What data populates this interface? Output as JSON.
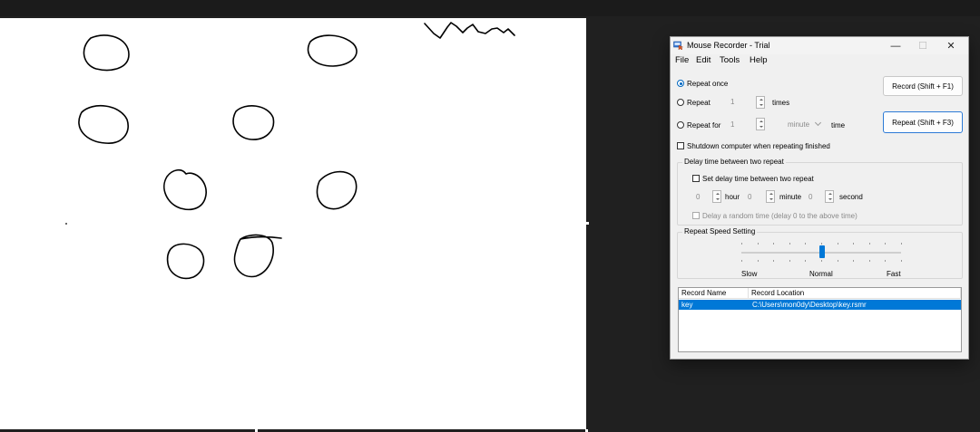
{
  "window": {
    "title": "Mouse Recorder - Trial",
    "accent_color": "#0078d7",
    "caption_buttons": {
      "minimize": "—",
      "maximize": "☐",
      "close": "✕"
    }
  },
  "menu": {
    "file": "File",
    "edit": "Edit",
    "tools": "Tools",
    "help": "Help"
  },
  "repeat": {
    "once_label": "Repeat once",
    "once_selected": true,
    "repeat_label": "Repeat",
    "repeat_value": "1",
    "times_label": "times",
    "for_label": "Repeat for",
    "for_value": "1",
    "unit_value": "minute",
    "time_label": "time",
    "shutdown_label": "Shutdown computer when repeating finished"
  },
  "buttons": {
    "record": "Record (Shift + F1)",
    "repeat": "Repeat (Shift + F3)"
  },
  "delay": {
    "group_title": "Delay time between two repeat",
    "set_label": "Set delay time between two repeat",
    "hour_value": "0",
    "hour_label": "hour",
    "minute_value": "0",
    "minute_label": "minute",
    "second_value": "0",
    "second_label": "second",
    "random_label": "Delay a random time (delay 0 to the above time)"
  },
  "speed": {
    "group_title": "Repeat Speed Setting",
    "slow_label": "Slow",
    "normal_label": "Normal",
    "fast_label": "Fast",
    "level_fraction": 0.5
  },
  "records": {
    "columns": [
      "Record Name",
      "Record Location"
    ],
    "rows": [
      {
        "name": "key",
        "location": "C:\\Users\\mon0dy\\Desktop\\key.rsmr",
        "selected": true
      }
    ]
  }
}
